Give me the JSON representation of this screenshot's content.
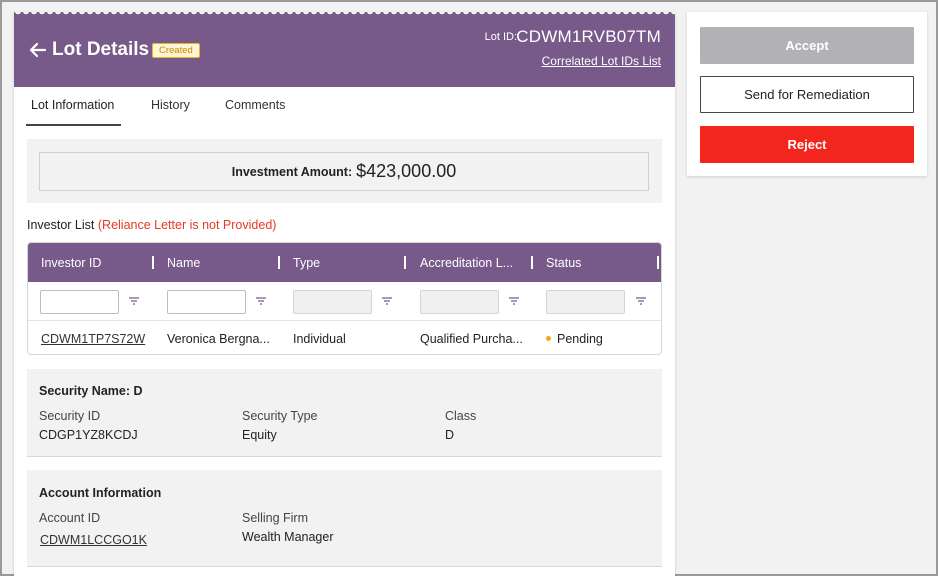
{
  "header": {
    "title": "Lot Details",
    "status_badge": "Created",
    "lot_id_label": "Lot ID:",
    "lot_id_value": "CDWM1RVB07TM",
    "correlated_link": "Correlated Lot IDs List"
  },
  "tabs": [
    {
      "label": "Lot Information",
      "active": true
    },
    {
      "label": "History",
      "active": false
    },
    {
      "label": "Comments",
      "active": false
    }
  ],
  "investment": {
    "label": "Investment Amount:",
    "value": "$423,000.00"
  },
  "investor_list": {
    "label": "Investor List",
    "warning": "(Reliance Letter is not Provided)",
    "columns": [
      "Investor ID",
      "Name",
      "Type",
      "Accreditation L...",
      "Status"
    ],
    "rows": [
      {
        "investor_id": "CDWM1TP7S72W",
        "name": "Veronica Bergna...",
        "type": "Individual",
        "accreditation": "Qualified Purcha...",
        "status": "Pending"
      }
    ]
  },
  "security": {
    "title": "Security Name: D",
    "fields": [
      {
        "label": "Security ID",
        "value": "CDGP1YZ8KCDJ"
      },
      {
        "label": "Security Type",
        "value": "Equity"
      },
      {
        "label": "Class",
        "value": "D"
      }
    ]
  },
  "account": {
    "title": "Account Information",
    "fields": [
      {
        "label": "Account ID",
        "value": "CDWM1LCCGO1K"
      },
      {
        "label": "Selling Firm",
        "value": "Wealth Manager"
      }
    ]
  },
  "actions": {
    "accept": "Accept",
    "remediation": "Send for Remediation",
    "reject": "Reject"
  },
  "colors": {
    "header_bg": "#785a8a",
    "reject_bg": "#f3261e",
    "accept_disabled_bg": "#b2b2b6",
    "warning_text": "#e53a23",
    "pending_dot": "#f0a81c"
  }
}
